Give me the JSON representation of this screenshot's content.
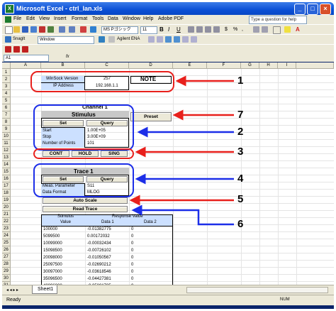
{
  "window": {
    "title": "Microsoft Excel - ctrl_lan.xls",
    "app_icon": "X"
  },
  "menu": {
    "items": [
      "File",
      "Edit",
      "View",
      "Insert",
      "Format",
      "Tools",
      "Data",
      "Window",
      "Help",
      "Adobe PDF"
    ],
    "help_placeholder": "Type a question for help"
  },
  "toolbar": {
    "font_name": "MS Pゴシック",
    "font_size": "11",
    "snagit_label": "SnagIt",
    "window_label": "Window",
    "agilent_label": "Agilent ENA"
  },
  "formula_bar": {
    "cell_ref": "A1",
    "fx": "fx"
  },
  "columns": [
    "A",
    "B",
    "C",
    "D",
    "E",
    "F",
    "G",
    "H",
    "I"
  ],
  "rows": [
    "1",
    "2",
    "3",
    "4",
    "5",
    "6",
    "7",
    "8",
    "9",
    "10",
    "11",
    "12",
    "13",
    "14",
    "15",
    "16",
    "17",
    "18",
    "19",
    "20",
    "21",
    "22",
    "23",
    "24",
    "25",
    "26",
    "27",
    "28",
    "29",
    "30",
    "31"
  ],
  "sheet": {
    "winsock_label": "WinSock Version",
    "winsock_value": "257",
    "ip_label": "IP Address",
    "ip_value": "192.168.1.1",
    "note": "NOTE",
    "channel": "Channel 1",
    "stimulus": "Stimulus",
    "set": "Set",
    "query": "Query",
    "preset": "Preset",
    "start_label": "Start",
    "start_value": "1.00E+05",
    "stop_label": "Stop",
    "stop_value": "3.00E+09",
    "points_label": "Number of Points",
    "points_value": "101",
    "cont": "CONT",
    "hold": "HOLD",
    "sing": "SING",
    "trace": "Trace 1",
    "set2": "Set",
    "query2": "Query",
    "meas_label": "Meas. Parameter",
    "meas_value": "S11",
    "fmt_label": "Data Format",
    "fmt_value": "MLOG",
    "autoscale": "Auto Scale",
    "readtrace": "Read Trace",
    "stim_hdr": "Stimulus",
    "stim_sub": "Value",
    "resp_hdr": "Response Value",
    "data1": "Data 1",
    "data2": "Data 2"
  },
  "table_rows": [
    {
      "stim": "100000",
      "d1": "-0.01382775",
      "d2": "0"
    },
    {
      "stim": "5099500",
      "d1": "0.00172032",
      "d2": "0"
    },
    {
      "stim": "10099000",
      "d1": "-0.00032434",
      "d2": "0"
    },
    {
      "stim": "15098500",
      "d1": "-0.00726102",
      "d2": "0"
    },
    {
      "stim": "20098000",
      "d1": "-0.01050567",
      "d2": "0"
    },
    {
      "stim": "25097500",
      "d1": "-0.02690212",
      "d2": "0"
    },
    {
      "stim": "30097000",
      "d1": "-0.03618546",
      "d2": "0"
    },
    {
      "stim": "35096500",
      "d1": "-0.04427381",
      "d2": "0"
    },
    {
      "stim": "40096000",
      "d1": "-0.05801735",
      "d2": "0"
    },
    {
      "stim": "45095500",
      "d1": "-0.07451835",
      "d2": "0"
    },
    {
      "stim": "50095000",
      "d1": "-0.09337308",
      "d2": "0"
    }
  ],
  "callouts": [
    "1",
    "7",
    "2",
    "3",
    "4",
    "5",
    "6"
  ],
  "callout_colors": {
    "red": "#e8201c",
    "blue": "#1c2ee8"
  },
  "tabs": {
    "sheet1": "Sheet1"
  },
  "status": {
    "ready": "Ready",
    "num": "NUM"
  }
}
